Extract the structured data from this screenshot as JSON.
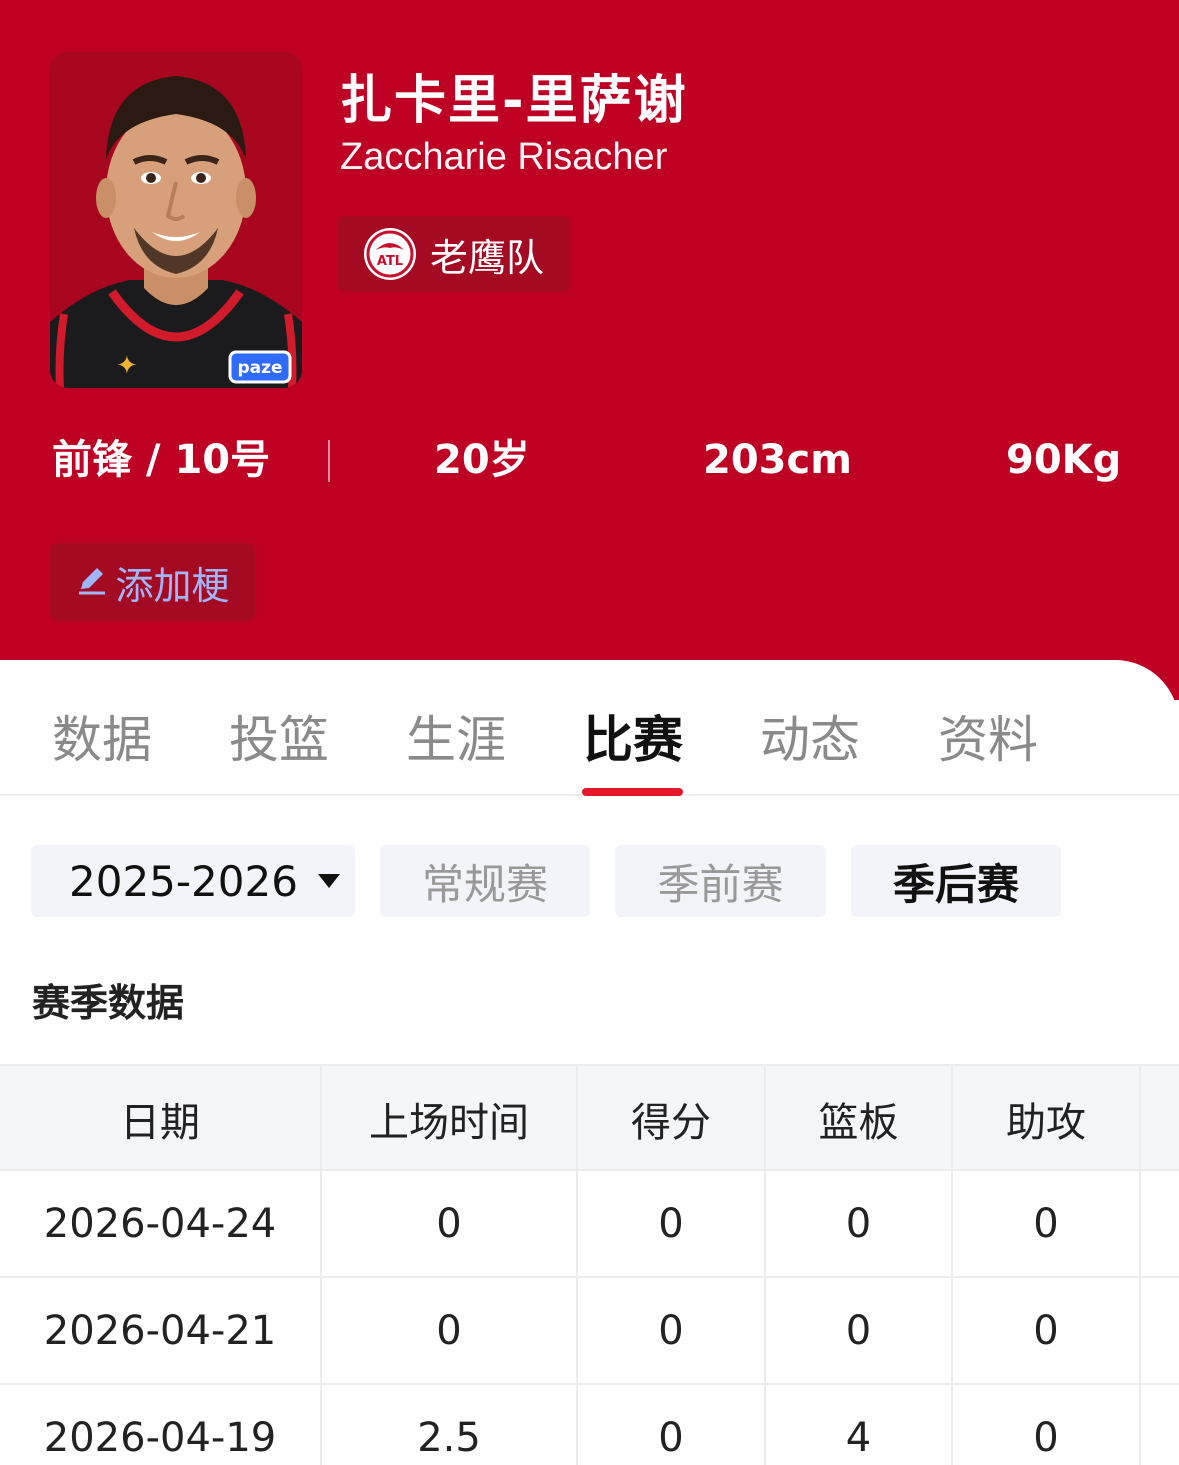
{
  "player": {
    "name_cn": "扎卡里-里萨谢",
    "name_en": "Zaccharie Risacher",
    "team": "老鹰队",
    "team_logo_text": "ATL",
    "jersey_sponsor": "paze",
    "position_number": "前锋 / 10号",
    "age": "20岁",
    "height": "203cm",
    "weight": "90Kg"
  },
  "meme_button": {
    "label": "添加梗"
  },
  "tabs": [
    {
      "label": "数据"
    },
    {
      "label": "投篮"
    },
    {
      "label": "生涯"
    },
    {
      "label": "比赛",
      "active": true
    },
    {
      "label": "动态"
    },
    {
      "label": "资料"
    }
  ],
  "filters": {
    "season": "2025-2026",
    "types": [
      {
        "label": "常规赛"
      },
      {
        "label": "季前赛"
      },
      {
        "label": "季后赛",
        "active": true
      }
    ]
  },
  "section_title": "赛季数据",
  "table": {
    "columns": [
      "日期",
      "上场时间",
      "得分",
      "篮板",
      "助攻"
    ],
    "rows": [
      [
        "2026-04-24",
        "0",
        "0",
        "0",
        "0"
      ],
      [
        "2026-04-21",
        "0",
        "0",
        "0",
        "0"
      ],
      [
        "2026-04-19",
        "2.5",
        "0",
        "4",
        "0"
      ]
    ]
  },
  "colors": {
    "header_red": "#bd0023",
    "accent": "#e8182c"
  }
}
